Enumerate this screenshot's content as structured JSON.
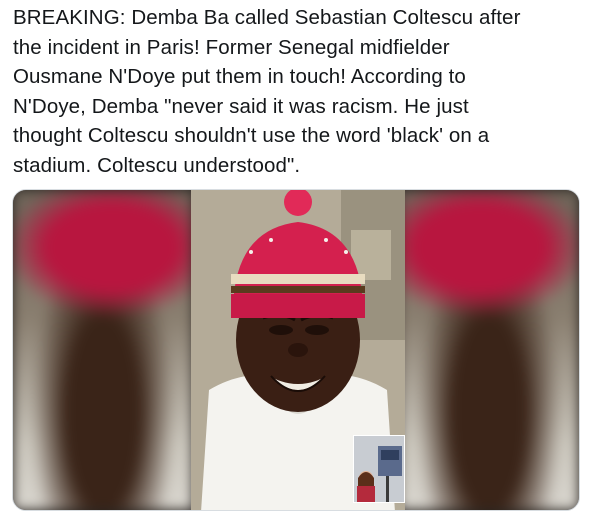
{
  "tweet": {
    "text": "BREAKING: Demba Ba called Sebastian Coltescu after\nthe incident in Paris! Former Senegal midfielder\nOusmane N'Doye put them in touch! According to\nN'Doye, Demba \"never said it was racism. He just\nthought Coltescu shouldn't use the word 'black' on a\nstadium. Coltescu understood\"."
  },
  "media": {
    "type": "video-call-photo",
    "subject_icon": "person-in-red-beanie",
    "pip_icon": "person-in-office",
    "colors": {
      "beanie": "#d4204e",
      "beanie_stripe": "#e8dcc0",
      "shirt": "#f4f3ef",
      "skin": "#3a1f14"
    }
  }
}
